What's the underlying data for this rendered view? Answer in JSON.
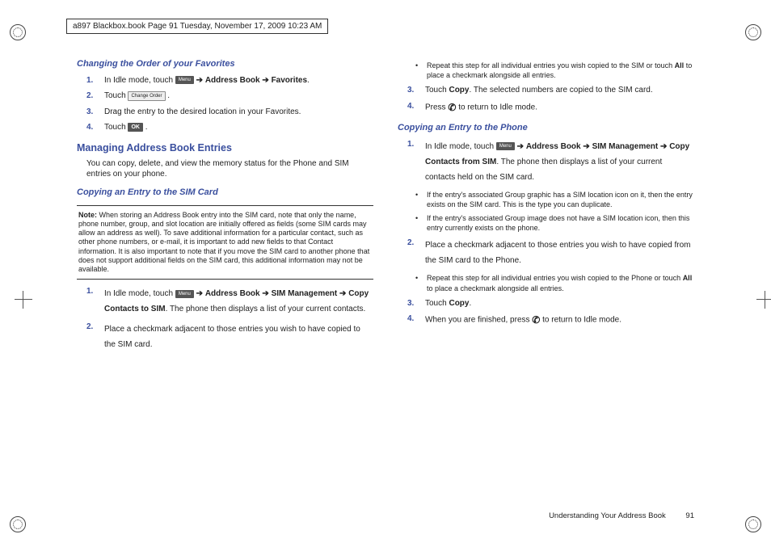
{
  "header": "a897 Blackbox.book  Page 91  Tuesday, November 17, 2009  10:23 AM",
  "left": {
    "h3a": "Changing the Order of your Favorites",
    "li1_a": " In Idle mode, touch ",
    "li1_b": "Address Book",
    "li1_c": "Favorites",
    "li2": "Touch ",
    "li3": "Drag the entry to the desired location in your Favorites.",
    "li4": "Touch ",
    "h2": "Managing Address Book Entries",
    "p1": "You can copy, delete, and view the memory status for the Phone and SIM entries on your phone.",
    "h3b": "Copying an Entry to the SIM Card",
    "note_label": "Note:",
    "note": "When storing an Address Book entry into the SIM card, note that only the name, phone number, group, and slot location are initially offered as fields (some SIM cards may allow an address as well). To save additional information for a particular contact, such as other phone numbers, or e-mail, it is important to add new fields to that Contact information. It is also important to note that if you move the SIM card to another phone that does not support additional fields on the SIM card, this additional information may not be available.",
    "s1_a": "In Idle mode, touch ",
    "s1_b": "Address Book",
    "s1_c": "SIM Management",
    "s1_d": "Copy Contacts to SIM",
    "s1_e": ". The phone then displays a list of your current contacts.",
    "s2": "Place a checkmark adjacent to those entries you wish to have copied to the SIM card."
  },
  "right": {
    "b1": "Repeat this step for all individual entries you wish copied to the SIM or touch ",
    "b1_all": "All",
    "b1_end": " to place a checkmark alongside all entries.",
    "li3a": "Touch ",
    "li3b": "Copy",
    "li3c": ". The selected numbers are copied to the SIM card.",
    "li4a": "Press ",
    "li4b": " to return to Idle mode.",
    "h3": "Copying an Entry to the Phone",
    "p1a": "In Idle mode, touch ",
    "p1b": "Address Book",
    "p1c": "SIM Management",
    "p1d": "Copy Contacts from SIM",
    "p1e": ". The phone then displays a list of your current contacts held on the SIM card.",
    "b2": "If the entry's associated Group graphic has a SIM location icon on it, then the entry exists on the SIM card. This is the type you can duplicate.",
    "b3": "If the entry's associated Group image does not have a SIM location icon, then this entry currently exists on the phone.",
    "li2": "Place a checkmark adjacent to those entries you wish to have copied from the SIM card to the Phone.",
    "b4": "Repeat this step for all individual entries you wish copied to the Phone or touch ",
    "b4_all": "All",
    "b4_end": " to place a checkmark alongside all entries.",
    "li3_2a": "Touch ",
    "li3_2b": "Copy",
    "li3_2c": ".",
    "li4_2a": "When you are finished, press ",
    "li4_2b": " to return to Idle mode."
  },
  "footer": {
    "text": "Understanding Your Address Book",
    "page": "91"
  },
  "icons": {
    "menu": "Menu",
    "change": "Change Order",
    "ok": "OK",
    "arrow": "➔"
  }
}
